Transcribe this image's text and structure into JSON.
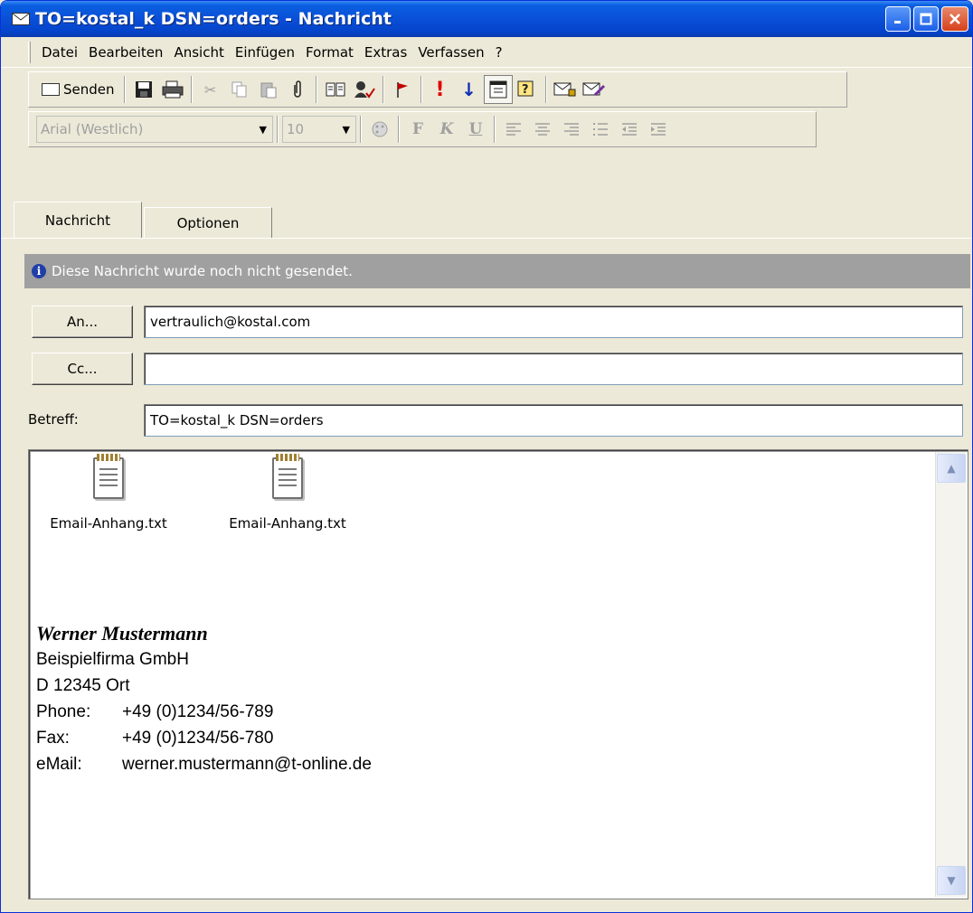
{
  "window": {
    "title": "TO=kostal_k DSN=orders - Nachricht"
  },
  "menu": [
    "Datei",
    "Bearbeiten",
    "Ansicht",
    "Einfügen",
    "Format",
    "Extras",
    "Verfassen",
    "?"
  ],
  "toolbar": {
    "send_label": "Senden"
  },
  "format_bar": {
    "font": "Arial (Westlich)",
    "size": "10",
    "bold": "F",
    "italic": "K",
    "underline": "U"
  },
  "tabs": [
    "Nachricht",
    "Optionen"
  ],
  "info_text": "Diese Nachricht wurde noch nicht gesendet.",
  "header": {
    "to_button": "An...",
    "cc_button": "Cc...",
    "to_value": "vertraulich@kostal.com",
    "cc_value": "",
    "subject_label": "Betreff:",
    "subject_value": "TO=kostal_k DSN=orders"
  },
  "attachments": [
    "Email-Anhang.txt",
    "Email-Anhang.txt"
  ],
  "signature": {
    "name": "Werner Mustermann",
    "company": "Beispielfirma GmbH",
    "city": "D 12345 Ort",
    "phone_label": "Phone:",
    "phone": "+49 (0)1234/56-789",
    "fax_label": "Fax:",
    "fax": "+49 (0)1234/56-780",
    "email_label": "eMail:",
    "email": "werner.mustermann@t-online.de"
  }
}
